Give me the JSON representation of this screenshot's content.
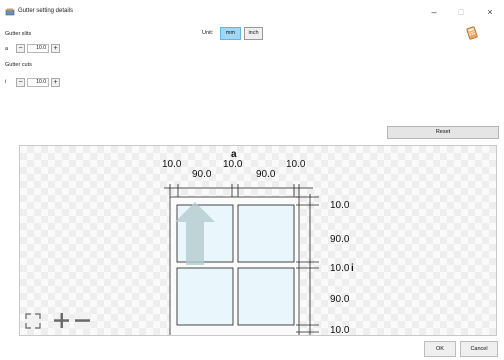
{
  "window": {
    "title": "Gutter setting details",
    "minimize": "–",
    "maximize": "□",
    "close": "×"
  },
  "gutter_slits": {
    "label": "Gutter slits",
    "param": "a",
    "minus": "−",
    "value": "10.0",
    "plus": "+"
  },
  "gutter_cuts": {
    "label": "Gutter cuts",
    "param": "i",
    "minus": "−",
    "value": "10.0",
    "plus": "+"
  },
  "unit": {
    "label": "Unit:",
    "options": [
      "mm",
      "inch"
    ],
    "selected": "mm"
  },
  "reset_label": "Reset",
  "preview": {
    "col_label": "a",
    "row_label": "i",
    "top_dims": [
      "10.0",
      "90.0",
      "10.0",
      "90.0",
      "10.0"
    ],
    "right_dims": [
      "10.0",
      "90.0",
      "10.0",
      "90.0",
      "10.0"
    ]
  },
  "footer": {
    "ok_label": "OK",
    "cancel_label": "Cancel"
  },
  "colors": {
    "accent": "#9fd7f5",
    "cell_fill": "#e9f6fb",
    "arrow": "#b3cccf"
  },
  "icons": {
    "app": "gutter-settings-icon",
    "calculator": "calculator-icon",
    "fit": "fit-to-window-icon",
    "zoom_in": "zoom-in-icon",
    "zoom_out": "zoom-out-icon"
  }
}
